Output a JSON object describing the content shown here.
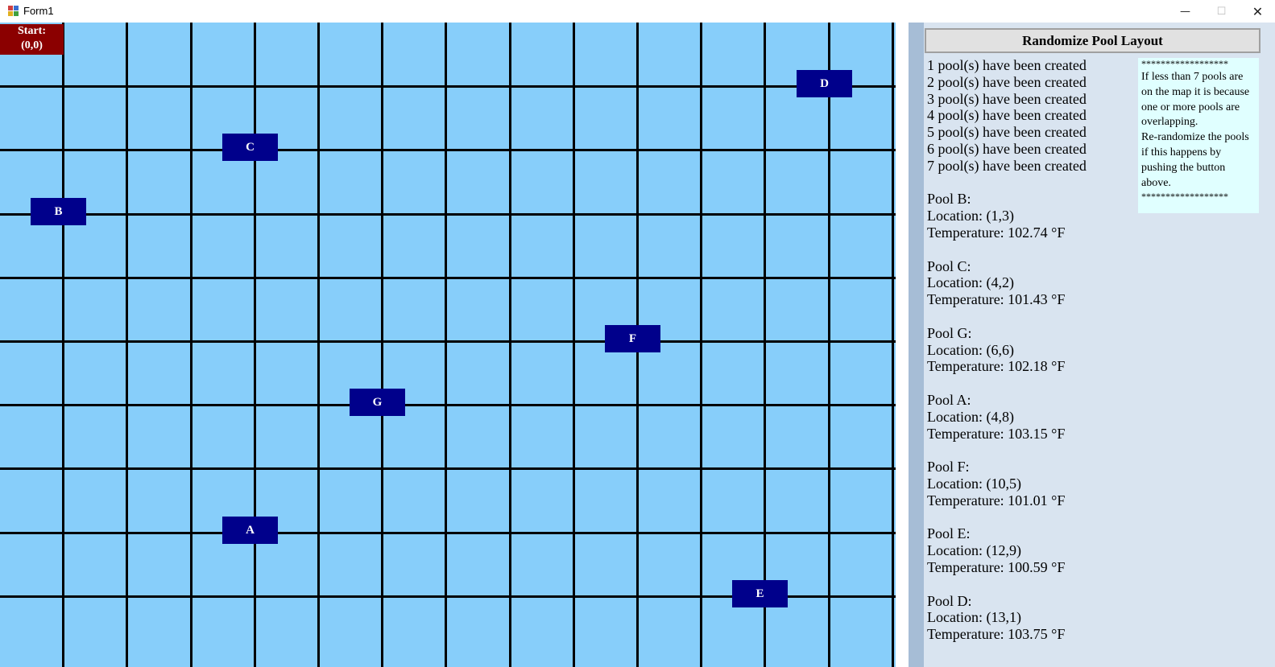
{
  "window": {
    "title": "Form1",
    "minimize_glyph": "—",
    "maximize_glyph": "☐",
    "close_glyph": "✕"
  },
  "grid": {
    "columns": 14,
    "rows": 10,
    "start_label": [
      "Start:",
      "(0,0)"
    ]
  },
  "pools": [
    {
      "name": "D",
      "col": 13,
      "row": 1
    },
    {
      "name": "C",
      "col": 4,
      "row": 2
    },
    {
      "name": "B",
      "col": 1,
      "row": 3
    },
    {
      "name": "F",
      "col": 10,
      "row": 5
    },
    {
      "name": "G",
      "col": 6,
      "row": 6
    },
    {
      "name": "A",
      "col": 4,
      "row": 8
    },
    {
      "name": "E",
      "col": 12,
      "row": 9
    }
  ],
  "controls": {
    "randomize_label": "Randomize Pool Layout"
  },
  "log": [
    "1 pool(s) have been created",
    "2 pool(s) have been created",
    "3 pool(s) have been created",
    "4 pool(s) have been created",
    "5 pool(s) have been created",
    "6 pool(s) have been created",
    "7 pool(s) have been created",
    "",
    "Pool B:",
    "Location: (1,3)",
    "Temperature: 102.74 °F",
    "",
    "Pool C:",
    "Location: (4,2)",
    "Temperature: 101.43 °F",
    "",
    "Pool G:",
    "Location: (6,6)",
    "Temperature: 102.18 °F",
    "",
    "Pool A:",
    "Location: (4,8)",
    "Temperature: 103.15 °F",
    "",
    "Pool F:",
    "Location: (10,5)",
    "Temperature: 101.01 °F",
    "",
    "Pool E:",
    "Location: (12,9)",
    "Temperature: 100.59 °F",
    "",
    "Pool D:",
    "Location: (13,1)",
    "Temperature: 103.75 °F"
  ],
  "note": [
    "******************",
    "If less than 7 pools are",
    "on the map it is because",
    "one or more pools are",
    "overlapping.",
    "Re-randomize the pools",
    "if this happens by",
    "pushing the button",
    "above.",
    "******************"
  ],
  "colors": {
    "grid_bg": "#87cefa",
    "pool": "#00008b",
    "start": "#8b0000",
    "note_bg": "#e0ffff"
  }
}
